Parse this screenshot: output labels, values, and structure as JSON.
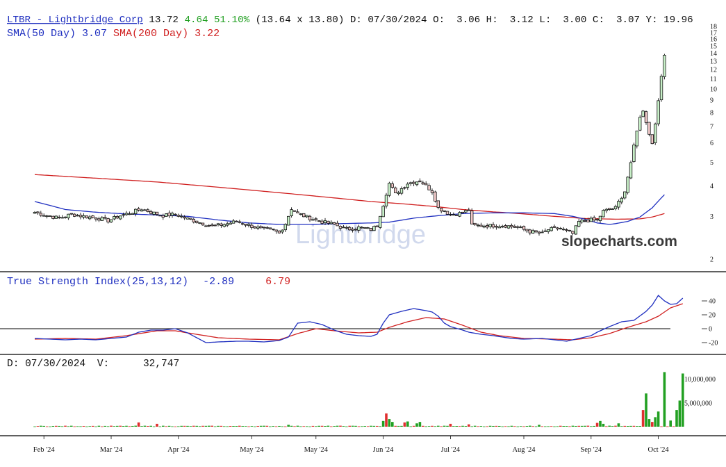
{
  "header": {
    "symbol_link": "LTBR - Lightbridge Corp",
    "last": "13.72",
    "change": "4.64",
    "change_pct": "51.10%",
    "bid_ask": "(13.64 x 13.80)",
    "date_label": "D: 07/30/2024",
    "ohlc": "O:  3.06 H:  3.12 L:  3.00 C:  3.07 Y: 19.96",
    "sma50_label": "SMA(50 Day) 3.07",
    "sma200_label": "SMA(200 Day) 3.22"
  },
  "watermark": {
    "logo_text": "Lightbridge",
    "brand": "slopecharts.com"
  },
  "tsi_panel": {
    "label": "True Strength Index(25,13,12)",
    "value_tsi": "-2.89",
    "value_signal": "6.79"
  },
  "volume_panel": {
    "date_label": "D: 07/30/2024",
    "volume_label": "V:",
    "volume_value": "32,747"
  },
  "colors": {
    "up": "#22a022",
    "down": "#e03030",
    "candle_up_fill": "#c8f0c8",
    "candle_down_fill": "#f0c8c8",
    "sma50": "#2030c0",
    "sma200": "#d02020",
    "tsi": "#2030c0",
    "tsi_signal": "#d02020",
    "link": "#2030c0",
    "text": "#111111"
  },
  "chart_data": [
    {
      "type": "candlestick",
      "panel": "price",
      "yscale": "log",
      "ylim": [
        1.95,
        18.5
      ],
      "y_ticks": [
        2,
        3,
        4,
        5,
        6,
        7,
        8,
        9,
        10,
        11,
        12,
        13,
        14,
        15,
        16,
        17,
        18
      ],
      "x_tick_labels": [
        "Feb '24",
        "Mar '24",
        "Apr '24",
        "May '24",
        "May '24",
        "Jun '24",
        "Jul '24",
        "Aug '24",
        "Sep '24",
        "Oct '24"
      ],
      "x_tick_index": [
        3,
        25,
        47,
        71,
        92,
        114,
        136,
        160,
        182,
        204
      ],
      "anchors": {
        "close": [
          [
            0,
            3.12
          ],
          [
            4,
            3.02
          ],
          [
            8,
            2.95
          ],
          [
            12,
            3.06
          ],
          [
            16,
            3.0
          ],
          [
            20,
            2.96
          ],
          [
            24,
            2.88
          ],
          [
            28,
            3.02
          ],
          [
            32,
            3.12
          ],
          [
            35,
            3.22
          ],
          [
            38,
            3.12
          ],
          [
            42,
            3.02
          ],
          [
            46,
            3.06
          ],
          [
            50,
            2.93
          ],
          [
            54,
            2.83
          ],
          [
            58,
            2.73
          ],
          [
            62,
            2.78
          ],
          [
            66,
            2.86
          ],
          [
            70,
            2.76
          ],
          [
            74,
            2.66
          ],
          [
            78,
            2.63
          ],
          [
            80,
            2.56
          ],
          [
            82,
            2.8
          ],
          [
            84,
            3.23
          ],
          [
            86,
            3.08
          ],
          [
            90,
            2.95
          ],
          [
            94,
            2.85
          ],
          [
            98,
            2.78
          ],
          [
            102,
            2.65
          ],
          [
            106,
            2.7
          ],
          [
            110,
            2.65
          ],
          [
            112,
            2.75
          ],
          [
            114,
            3.35
          ],
          [
            116,
            4.1
          ],
          [
            118,
            3.7
          ],
          [
            122,
            4.1
          ],
          [
            126,
            4.2
          ],
          [
            130,
            3.8
          ],
          [
            132,
            3.25
          ],
          [
            136,
            3.05
          ],
          [
            140,
            3.1
          ],
          [
            142,
            3.2
          ],
          [
            143,
            2.75
          ],
          [
            146,
            2.75
          ],
          [
            150,
            2.75
          ],
          [
            154,
            2.75
          ],
          [
            158,
            2.7
          ],
          [
            162,
            2.6
          ],
          [
            166,
            2.55
          ],
          [
            168,
            2.65
          ],
          [
            172,
            2.68
          ],
          [
            174,
            2.6
          ],
          [
            176,
            2.55
          ],
          [
            178,
            2.85
          ],
          [
            182,
            2.9
          ],
          [
            184,
            2.88
          ],
          [
            186,
            3.15
          ],
          [
            190,
            3.25
          ],
          [
            193,
            3.8
          ],
          [
            195,
            4.9
          ],
          [
            197,
            6.8
          ],
          [
            198,
            7.6
          ],
          [
            199,
            8.2
          ],
          [
            201,
            6.5
          ],
          [
            202,
            6.0
          ],
          [
            203,
            7.3
          ],
          [
            204,
            8.8
          ],
          [
            206,
            13.72
          ]
        ]
      },
      "extremes": {
        "high": 13.8,
        "low": 2.45
      },
      "sma50": [
        [
          0,
          3.45
        ],
        [
          10,
          3.2
        ],
        [
          20,
          3.12
        ],
        [
          30,
          3.07
        ],
        [
          40,
          3.04
        ],
        [
          50,
          3.0
        ],
        [
          60,
          2.9
        ],
        [
          70,
          2.82
        ],
        [
          80,
          2.78
        ],
        [
          90,
          2.78
        ],
        [
          100,
          2.8
        ],
        [
          110,
          2.82
        ],
        [
          116,
          2.84
        ],
        [
          124,
          2.95
        ],
        [
          132,
          3.02
        ],
        [
          140,
          3.08
        ],
        [
          150,
          3.1
        ],
        [
          160,
          3.1
        ],
        [
          170,
          3.08
        ],
        [
          176,
          3.0
        ],
        [
          180,
          2.92
        ],
        [
          184,
          2.82
        ],
        [
          188,
          2.78
        ],
        [
          190,
          2.8
        ],
        [
          194,
          2.86
        ],
        [
          198,
          2.98
        ],
        [
          202,
          3.25
        ],
        [
          206,
          3.68
        ]
      ],
      "sma200": [
        [
          0,
          4.45
        ],
        [
          20,
          4.3
        ],
        [
          40,
          4.15
        ],
        [
          60,
          3.95
        ],
        [
          80,
          3.75
        ],
        [
          100,
          3.55
        ],
        [
          110,
          3.45
        ],
        [
          120,
          3.38
        ],
        [
          130,
          3.3
        ],
        [
          140,
          3.2
        ],
        [
          150,
          3.13
        ],
        [
          160,
          3.07
        ],
        [
          170,
          3.0
        ],
        [
          180,
          2.94
        ],
        [
          190,
          2.92
        ],
        [
          198,
          2.93
        ],
        [
          202,
          2.98
        ],
        [
          206,
          3.08
        ]
      ]
    },
    {
      "type": "line",
      "panel": "tsi",
      "ylim": [
        -32,
        58
      ],
      "y_ticks": [
        40,
        20,
        0,
        -20
      ],
      "series": [
        {
          "name": "True Strength Index(25,13,12)",
          "color": "#2030c0",
          "values": [
            [
              0,
              -14
            ],
            [
              5,
              -15
            ],
            [
              10,
              -16
            ],
            [
              15,
              -15
            ],
            [
              20,
              -16
            ],
            [
              25,
              -14
            ],
            [
              30,
              -12
            ],
            [
              34,
              -5
            ],
            [
              38,
              -2
            ],
            [
              42,
              -2
            ],
            [
              46,
              0
            ],
            [
              50,
              -6
            ],
            [
              56,
              -20
            ],
            [
              60,
              -19
            ],
            [
              66,
              -18
            ],
            [
              70,
              -18
            ],
            [
              75,
              -19
            ],
            [
              80,
              -17
            ],
            [
              83,
              -12
            ],
            [
              86,
              8
            ],
            [
              90,
              10
            ],
            [
              94,
              6
            ],
            [
              98,
              -2
            ],
            [
              102,
              -8
            ],
            [
              106,
              -10
            ],
            [
              110,
              -11
            ],
            [
              112,
              -8
            ],
            [
              114,
              8
            ],
            [
              116,
              20
            ],
            [
              120,
              25
            ],
            [
              124,
              29
            ],
            [
              128,
              26
            ],
            [
              130,
              24
            ],
            [
              132,
              18
            ],
            [
              134,
              8
            ],
            [
              136,
              3
            ],
            [
              140,
              -2
            ],
            [
              142,
              -5
            ],
            [
              146,
              -8
            ],
            [
              150,
              -10
            ],
            [
              156,
              -14
            ],
            [
              160,
              -15
            ],
            [
              166,
              -14
            ],
            [
              170,
              -16
            ],
            [
              174,
              -18
            ],
            [
              176,
              -16
            ],
            [
              180,
              -12
            ],
            [
              182,
              -10
            ],
            [
              184,
              -5
            ],
            [
              188,
              3
            ],
            [
              192,
              10
            ],
            [
              196,
              12
            ],
            [
              200,
              25
            ],
            [
              202,
              34
            ],
            [
              204,
              48
            ],
            [
              206,
              40
            ],
            [
              208,
              35
            ],
            [
              210,
              36
            ],
            [
              212,
              44
            ]
          ]
        },
        {
          "name": "signal",
          "color": "#d02020",
          "values": [
            [
              0,
              -15
            ],
            [
              10,
              -14
            ],
            [
              20,
              -15
            ],
            [
              30,
              -10
            ],
            [
              40,
              -3
            ],
            [
              46,
              -3
            ],
            [
              50,
              -6
            ],
            [
              60,
              -13
            ],
            [
              70,
              -15
            ],
            [
              80,
              -16
            ],
            [
              86,
              -7
            ],
            [
              92,
              0
            ],
            [
              98,
              -3
            ],
            [
              106,
              -6
            ],
            [
              112,
              -5
            ],
            [
              116,
              2
            ],
            [
              122,
              10
            ],
            [
              128,
              16
            ],
            [
              134,
              14
            ],
            [
              140,
              5
            ],
            [
              146,
              -5
            ],
            [
              152,
              -10
            ],
            [
              160,
              -14
            ],
            [
              170,
              -15
            ],
            [
              176,
              -16
            ],
            [
              182,
              -13
            ],
            [
              188,
              -7
            ],
            [
              194,
              2
            ],
            [
              200,
              10
            ],
            [
              204,
              18
            ],
            [
              208,
              30
            ],
            [
              212,
              36
            ]
          ]
        }
      ]
    },
    {
      "type": "bar",
      "panel": "volume",
      "ylim": [
        0,
        12000000
      ],
      "y_ticks": [
        5000000,
        10000000
      ],
      "y_tick_labels": [
        "5,000,000",
        "10,000,000"
      ],
      "spikes": [
        [
          34,
          900000
        ],
        [
          40,
          600000
        ],
        [
          83,
          400000
        ],
        [
          114,
          1200000
        ],
        [
          115,
          2800000
        ],
        [
          116,
          1600000
        ],
        [
          117,
          1000000
        ],
        [
          121,
          900000
        ],
        [
          122,
          1100000
        ],
        [
          125,
          700000
        ],
        [
          126,
          1000000
        ],
        [
          136,
          600000
        ],
        [
          142,
          500000
        ],
        [
          165,
          400000
        ],
        [
          184,
          800000
        ],
        [
          185,
          1200000
        ],
        [
          186,
          600000
        ],
        [
          191,
          700000
        ],
        [
          199,
          3500000
        ],
        [
          200,
          7000000
        ],
        [
          201,
          1600000
        ],
        [
          202,
          1000000
        ],
        [
          203,
          2000000
        ],
        [
          204,
          3200000
        ],
        [
          206,
          11500000
        ],
        [
          208,
          1300000
        ],
        [
          210,
          3500000
        ],
        [
          211,
          5500000
        ],
        [
          212,
          11200000
        ]
      ],
      "base_volume": 150000,
      "last_up_index": 212
    }
  ]
}
